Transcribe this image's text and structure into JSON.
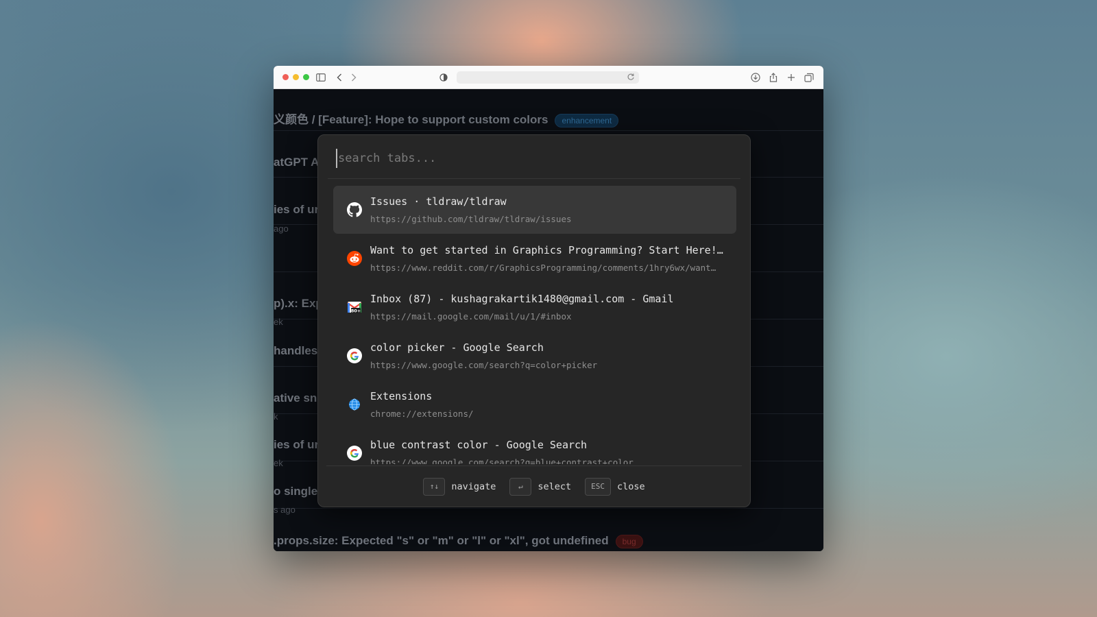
{
  "browser": {
    "url": ""
  },
  "background_page": {
    "rows": [
      {
        "title": "义颜色 / [Feature]: Hope to support custom colors",
        "badge": "enhancement",
        "sub": ""
      },
      {
        "title": "atGPT At",
        "badge": "",
        "sub": ""
      },
      {
        "title": "ies of ur",
        "badge": "",
        "sub": "ago"
      },
      {
        "title": "",
        "badge": "",
        "sub": ""
      },
      {
        "title": "p).x: Exp",
        "badge": "",
        "sub": "ek"
      },
      {
        "title": "handles",
        "badge": "",
        "sub": ""
      },
      {
        "title": "ative sn",
        "badge": "",
        "sub": "k"
      },
      {
        "title": "ies of ur",
        "badge": "",
        "sub": "ek"
      },
      {
        "title": "o single",
        "badge": "",
        "sub": "s ago"
      },
      {
        "title": ".props.size: Expected \"s\" or \"m\" or \"l\" or \"xl\", got undefined",
        "badge": "bug",
        "sub": ""
      }
    ]
  },
  "palette": {
    "search": {
      "placeholder": "search tabs...",
      "value": ""
    },
    "tabs": [
      {
        "title": "Issues · tldraw/tldraw",
        "url": "https://github.com/tldraw/tldraw/issues",
        "icon": "github-icon",
        "selected": true
      },
      {
        "title": "Want to get started in Graphics Programming? Start Here!…",
        "url": "https://www.reddit.com/r/GraphicsProgramming/comments/1hry6wx/want…",
        "icon": "reddit-icon",
        "selected": false
      },
      {
        "title": "Inbox (87) - kushagrakartik1480@gmail.com - Gmail",
        "url": "https://mail.google.com/mail/u/1/#inbox",
        "icon": "gmail-icon",
        "selected": false
      },
      {
        "title": "color picker - Google Search",
        "url": "https://www.google.com/search?q=color+picker",
        "icon": "google-icon",
        "selected": false
      },
      {
        "title": "Extensions",
        "url": "chrome://extensions/",
        "icon": "globe-icon",
        "selected": false
      },
      {
        "title": "blue contrast color - Google Search",
        "url": "https://www.google.com/search?q=blue+contrast+color",
        "icon": "google-icon",
        "selected": false
      }
    ],
    "footer": {
      "navigate_key": "↑↓",
      "navigate_label": "navigate",
      "select_key": "↵",
      "select_label": "select",
      "close_key": "ESC",
      "close_label": "close"
    },
    "gmail_badge": "80+"
  },
  "colors": {
    "enhancement_badge": "#2f6a96",
    "bug_badge": "#7a2c2c",
    "palette_bg": "#262626",
    "selected_row": "#383838"
  }
}
